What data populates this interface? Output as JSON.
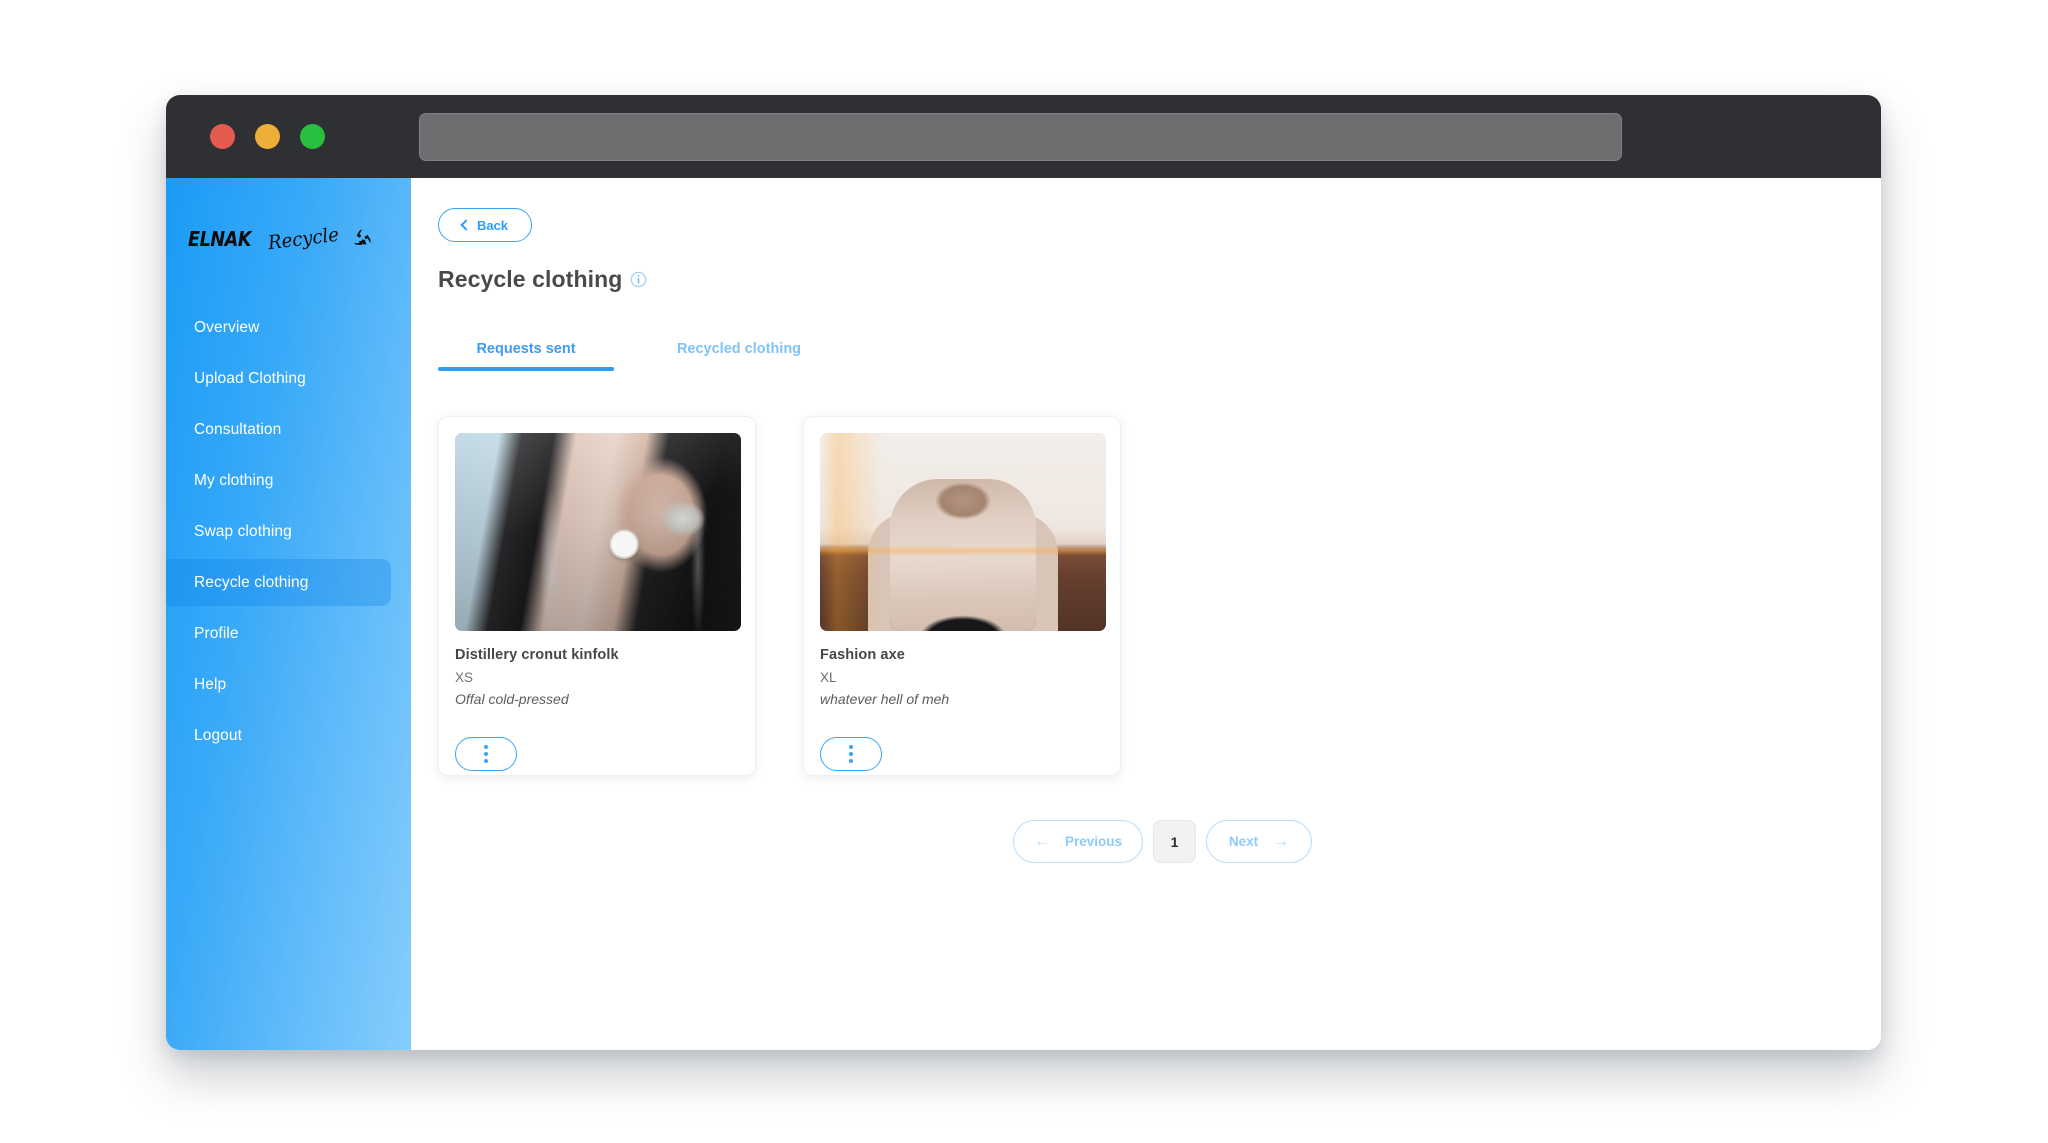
{
  "window": {
    "traffic_lights": [
      {
        "name": "close",
        "color": "#e35b4e"
      },
      {
        "name": "minimize",
        "color": "#eeae38"
      },
      {
        "name": "maximize",
        "color": "#28c03e"
      }
    ],
    "address_bar_value": "",
    "address_bar_placeholder": ""
  },
  "sidebar": {
    "logo": {
      "brand": "ELNAK",
      "word": "Recycle",
      "mark": "recycle-icon"
    },
    "items": [
      {
        "label": "Overview",
        "active": false
      },
      {
        "label": "Upload Clothing",
        "active": false
      },
      {
        "label": "Consultation",
        "active": false
      },
      {
        "label": "My clothing",
        "active": false
      },
      {
        "label": "Swap clothing",
        "active": false
      },
      {
        "label": "Recycle clothing",
        "active": true
      },
      {
        "label": "Profile",
        "active": false
      },
      {
        "label": "Help",
        "active": false
      },
      {
        "label": "Logout",
        "active": false
      }
    ],
    "gradient_from": "#1a9bf6",
    "gradient_to": "#86cdfc"
  },
  "main": {
    "back_label": "Back",
    "page_title": "Recycle clothing",
    "info_icon": "info-circle-icon",
    "tabs": [
      {
        "label": "Requests sent",
        "active": true
      },
      {
        "label": "Recycled clothing",
        "active": false
      }
    ],
    "cards": [
      {
        "title": "Distillery cronut kinfolk",
        "size": "XS",
        "description": "Offal cold-pressed",
        "photo": "leather-jacket-wristwatch-photo",
        "menu_icon": "vertical-dots-icon"
      },
      {
        "title": "Fashion axe",
        "size": "XL",
        "description": "whatever hell of meh",
        "photo": "hoodie-sunset-portrait-photo",
        "menu_icon": "vertical-dots-icon"
      }
    ],
    "pagination": {
      "previous_label": "Previous",
      "previous_arrow": "←",
      "current_page": "1",
      "next_label": "Next",
      "next_arrow": "→"
    }
  },
  "colors": {
    "accent": "#2d9cf5",
    "accent_light": "#8ccbfb",
    "titlebar": "#2f3033",
    "text_dark": "#474747",
    "text_muted": "#6f6f6f"
  }
}
